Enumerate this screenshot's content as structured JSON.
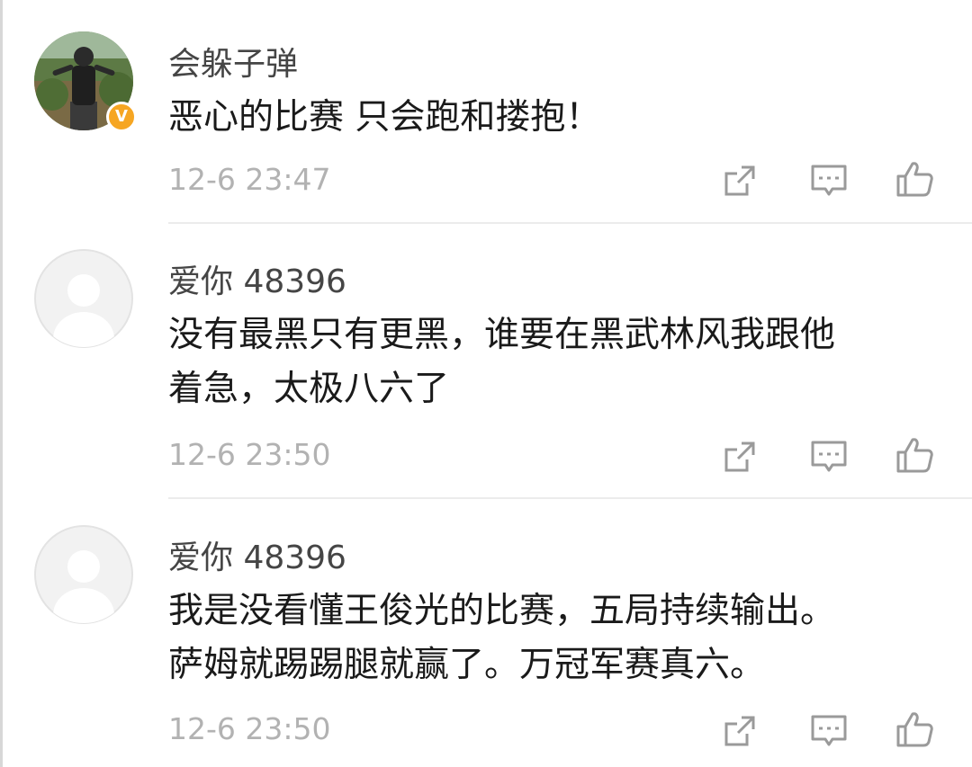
{
  "comments": [
    {
      "username": "会躲子弹",
      "verified": true,
      "verified_badge": "V",
      "lines": [
        "恶心的比赛 只会跑和搂抱！"
      ],
      "time": "12-6 23:47"
    },
    {
      "username": "爱你 48396",
      "verified": false,
      "lines": [
        "没有最黑只有更黑，谁要在黑武林风我跟他",
        "着急，太极八六了"
      ],
      "time": "12-6 23:50"
    },
    {
      "username": "爱你 48396",
      "verified": false,
      "lines": [
        "我是没看懂王俊光的比赛，五局持续输出。",
        "萨姆就踢踢腿就赢了。万冠军赛真六。"
      ],
      "time": "12-6 23:50"
    }
  ],
  "icons": {
    "share": "share-icon",
    "reply": "comment-icon",
    "like": "thumbs-up-icon"
  },
  "colors": {
    "text": "#1a1a1a",
    "username": "#454545",
    "time": "#b2b2b2",
    "icon": "#9a9a9a",
    "badge": "#f6a623"
  }
}
